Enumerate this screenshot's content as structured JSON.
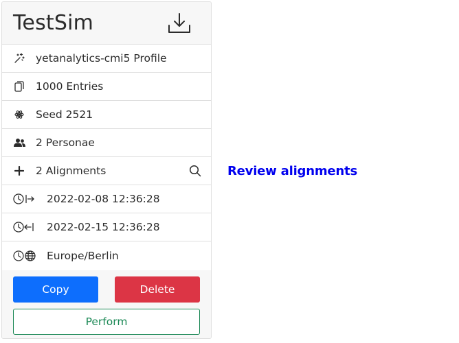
{
  "card": {
    "title": "TestSim",
    "download_icon": "download-icon"
  },
  "rows": {
    "profile": {
      "icon": "magic-wand-icon",
      "label": "yetanalytics-cmi5 Profile"
    },
    "entries": {
      "icon": "copy-pages-icon",
      "label": "1000 Entries"
    },
    "seed": {
      "icon": "atom-icon",
      "label": "Seed 2521"
    },
    "personae": {
      "icon": "people-icon",
      "label": "2 Personae"
    },
    "alignments": {
      "icon": "plus-icon",
      "label": "2 Alignments",
      "action_icon": "search-icon"
    },
    "start": {
      "icon": "clock-start-icon",
      "label": "2022-02-08 12:36:28"
    },
    "end": {
      "icon": "clock-end-icon",
      "label": "2022-02-15 12:36:28"
    },
    "timezone": {
      "icon": "clock-globe-icon",
      "label": "Europe/Berlin"
    }
  },
  "buttons": {
    "copy": "Copy",
    "delete": "Delete",
    "perform": "Perform"
  },
  "review_link": "Review alignments",
  "colors": {
    "primary": "#0d6efd",
    "danger": "#dc3545",
    "success": "#198754",
    "link": "#0000ee",
    "header_bg": "#f7f7f7"
  }
}
